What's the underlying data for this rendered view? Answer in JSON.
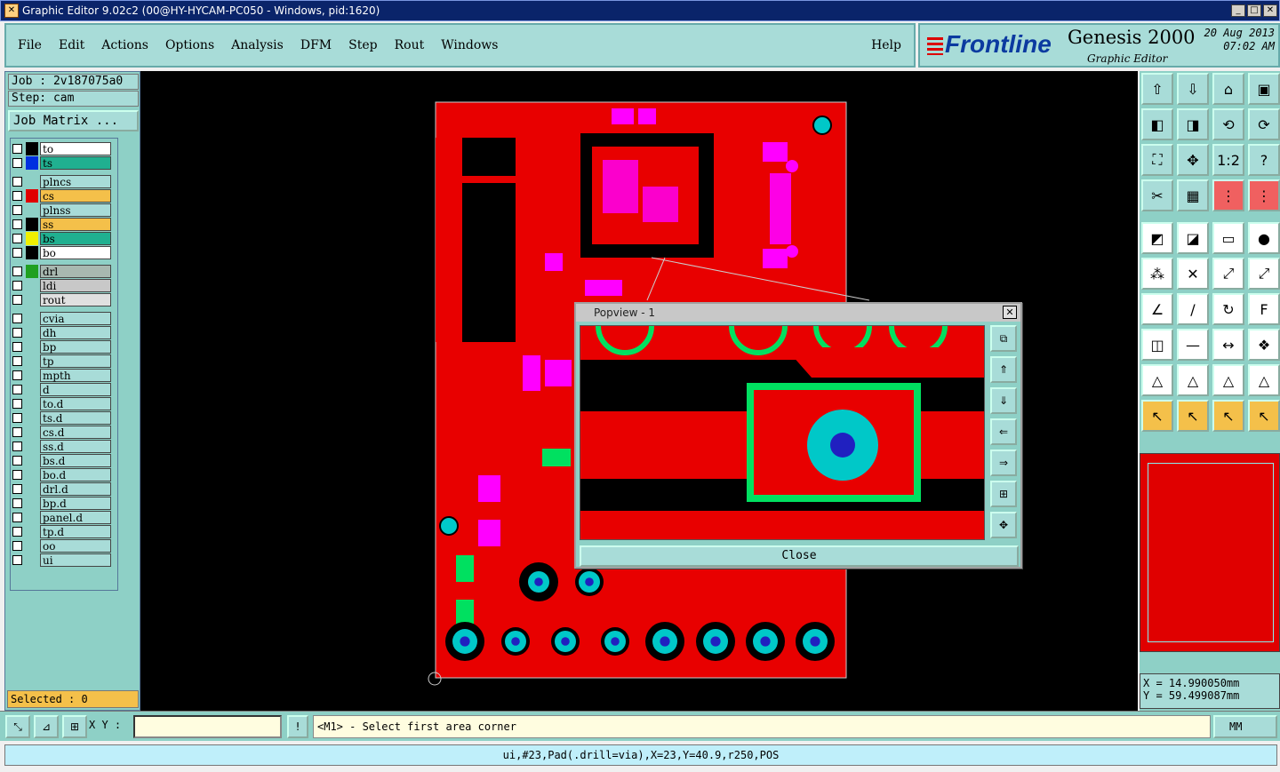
{
  "window": {
    "title": "Graphic Editor 9.02c2 (00@HY-HYCAM-PC050 - Windows, pid:1620)"
  },
  "menu": {
    "items": [
      "File",
      "Edit",
      "Actions",
      "Options",
      "Analysis",
      "DFM",
      "Step",
      "Rout",
      "Windows"
    ],
    "help": "Help"
  },
  "brand": {
    "logo": "Frontline",
    "product": "Genesis 2000",
    "subtitle": "Graphic Editor",
    "date": "20 Aug 2013",
    "time": "07:02 AM"
  },
  "job": {
    "job_label": "Job : 2v187075a0",
    "step_label": "Step: cam",
    "matrix_button": "Job Matrix ..."
  },
  "layers": [
    {
      "name": "to",
      "color": "#000000",
      "bg": "#ffffff"
    },
    {
      "name": "ts",
      "color": "#0030e0",
      "bg": "#20b090"
    },
    {
      "name": "plncs",
      "color": "",
      "bg": "#a8dcd8"
    },
    {
      "name": "cs",
      "color": "#e00000",
      "bg": "#f4c04a"
    },
    {
      "name": "plnss",
      "color": "",
      "bg": "#a8dcd8"
    },
    {
      "name": "ss",
      "color": "#000000",
      "bg": "#f4c04a"
    },
    {
      "name": "bs",
      "color": "#f0f000",
      "bg": "#20b090"
    },
    {
      "name": "bo",
      "color": "#000000",
      "bg": "#ffffff"
    },
    {
      "name": "drl",
      "color": "#20a020",
      "bg": "#a8b8b0"
    },
    {
      "name": "ldi",
      "color": "",
      "bg": "#c8c8c8"
    },
    {
      "name": "rout",
      "color": "",
      "bg": "#e0e0e0"
    },
    {
      "name": "cvia",
      "color": "",
      "bg": "#a8dcd8"
    },
    {
      "name": "dh",
      "color": "",
      "bg": "#a8dcd8"
    },
    {
      "name": "bp",
      "color": "",
      "bg": "#a8dcd8"
    },
    {
      "name": "tp",
      "color": "",
      "bg": "#a8dcd8"
    },
    {
      "name": "mpth",
      "color": "",
      "bg": "#a8dcd8"
    },
    {
      "name": "d",
      "color": "",
      "bg": "#a8dcd8"
    },
    {
      "name": "to.d",
      "color": "",
      "bg": "#a8dcd8"
    },
    {
      "name": "ts.d",
      "color": "",
      "bg": "#a8dcd8"
    },
    {
      "name": "cs.d",
      "color": "",
      "bg": "#a8dcd8"
    },
    {
      "name": "ss.d",
      "color": "",
      "bg": "#a8dcd8"
    },
    {
      "name": "bs.d",
      "color": "",
      "bg": "#a8dcd8"
    },
    {
      "name": "bo.d",
      "color": "",
      "bg": "#a8dcd8"
    },
    {
      "name": "drl.d",
      "color": "",
      "bg": "#a8dcd8"
    },
    {
      "name": "bp.d",
      "color": "",
      "bg": "#a8dcd8"
    },
    {
      "name": "panel.d",
      "color": "",
      "bg": "#a8dcd8"
    },
    {
      "name": "tp.d",
      "color": "",
      "bg": "#a8dcd8"
    },
    {
      "name": "oo",
      "color": "",
      "bg": "#a8dcd8"
    },
    {
      "name": "ui",
      "color": "",
      "bg": "#a8dcd8"
    }
  ],
  "selected": "Selected : 0",
  "popup": {
    "title": "Popview - 1",
    "close": "Close"
  },
  "coords": {
    "x": "X  =  14.990050mm",
    "y": "Y  =  59.499087mm"
  },
  "bottom": {
    "xy_label": "X Y :",
    "xy_value": "",
    "prompt": "<M1> - Select first area corner",
    "unit": "MM"
  },
  "status": "ui,#23,Pad(.drill=via),X=23,Y=40.9,r250,POS",
  "toolbar_icons": [
    "home-up",
    "home-down",
    "home",
    "window",
    "zoom-left",
    "zoom-right",
    "undo-view",
    "redraw",
    "fit-all",
    "fit-profile",
    "one-to-two",
    "help",
    "measure",
    "grid",
    "layer-red",
    "layer-red-2",
    "pick",
    "select-region",
    "ruler",
    "circle",
    "connect",
    "cross-net",
    "snap-red",
    "snap-red-2",
    "line-red",
    "line-blue",
    "arc",
    "text-f",
    "pad-red",
    "line-dash",
    "dimension",
    "shapes",
    "triangle-1",
    "triangle-2",
    "triangle-3",
    "triangle-4",
    "cursor-1",
    "cursor-2",
    "cursor-3",
    "cursor-4"
  ],
  "colors": {
    "copper": "#e80000",
    "pad": "#ff00ff",
    "drill": "#00c8c8",
    "via": "#2020c0",
    "mask": "#00e060"
  }
}
